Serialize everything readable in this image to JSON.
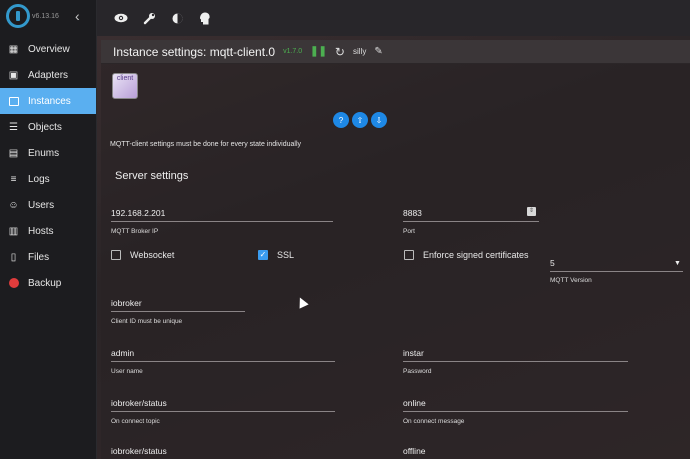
{
  "sidebar": {
    "version": "v6.13.16",
    "collapse_icon": "chevron-left-icon",
    "items": [
      {
        "label": "Overview",
        "icon": "grid-icon"
      },
      {
        "label": "Adapters",
        "icon": "store-icon"
      },
      {
        "label": "Instances",
        "icon": "instances-icon",
        "active": true
      },
      {
        "label": "Objects",
        "icon": "list-icon"
      },
      {
        "label": "Enums",
        "icon": "enum-icon"
      },
      {
        "label": "Logs",
        "icon": "log-icon"
      },
      {
        "label": "Users",
        "icon": "user-icon"
      },
      {
        "label": "Hosts",
        "icon": "hosts-icon"
      },
      {
        "label": "Files",
        "icon": "file-icon"
      },
      {
        "label": "Backup",
        "icon": "backup-icon"
      }
    ]
  },
  "toolbar": {
    "icons": [
      "eye-icon",
      "wrench-icon",
      "theme-icon",
      "expert-mode-icon"
    ]
  },
  "instance": {
    "title": "Instance settings: mqtt-client.0",
    "version": "v1.7.0",
    "log_level": "silly",
    "adapter_logo_text": "client"
  },
  "note": "MQTT-client settings must be done for every state individually",
  "section_title": "Server settings",
  "fields": {
    "broker_ip": {
      "value": "192.168.2.201",
      "label": "MQTT Broker IP"
    },
    "port": {
      "value": "8883",
      "label": "Port"
    },
    "websocket": {
      "label": "Websocket",
      "checked": false
    },
    "ssl": {
      "label": "SSL",
      "checked": true
    },
    "enforce_certs": {
      "label": "Enforce signed certificates",
      "checked": false
    },
    "mqtt_version": {
      "value": "5",
      "label": "MQTT Version"
    },
    "client_id": {
      "value": "iobroker",
      "label": "Client ID must be unique"
    },
    "username": {
      "value": "admin",
      "label": "User name"
    },
    "password": {
      "value": "instar",
      "label": "Password"
    },
    "on_connect_topic": {
      "value": "iobroker/status",
      "label": "On connect topic"
    },
    "on_connect_message": {
      "value": "online",
      "label": "On connect message"
    },
    "last_will_topic": {
      "value": "iobroker/status"
    },
    "last_will_message": {
      "value": "offline"
    }
  },
  "colors": {
    "accent": "#5aaff0",
    "button": "#1e88e5",
    "running": "#4caf50",
    "backup": "#e03c3c"
  }
}
